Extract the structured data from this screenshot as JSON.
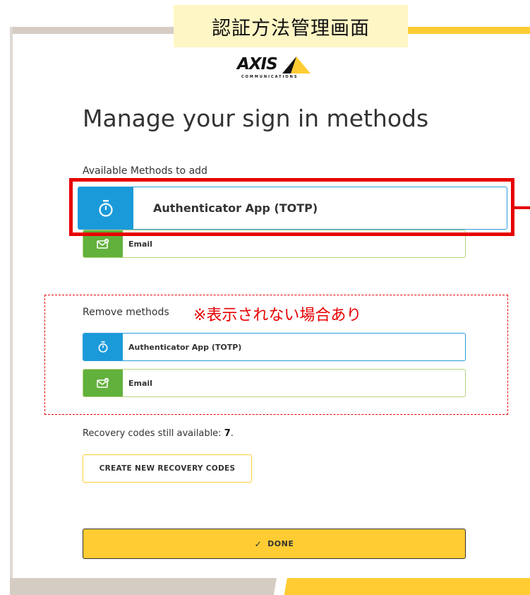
{
  "annotation": {
    "jp_title": "認証方法管理画面",
    "jp_note": "※表示されない場合あり"
  },
  "brand": {
    "logo_text": "AXIS",
    "logo_subtext": "COMMUNICATIONS",
    "accent_color": "#ffcc33",
    "totp_color": "#1b9ad9",
    "email_color": "#62b13d",
    "highlight_color": "#e60000"
  },
  "page": {
    "title": "Manage your sign in methods"
  },
  "available": {
    "label": "Available Methods to add",
    "methods": [
      {
        "label": "Authenticator App (TOTP)",
        "icon": "stopwatch-icon"
      },
      {
        "label": "Email",
        "icon": "envelope-icon"
      }
    ]
  },
  "remove": {
    "label": "Remove methods",
    "methods": [
      {
        "label": "Authenticator App (TOTP)",
        "icon": "stopwatch-icon"
      },
      {
        "label": "Email",
        "icon": "envelope-icon"
      }
    ]
  },
  "recovery": {
    "text_prefix": "Recovery codes still available: ",
    "count": "7",
    "text_suffix": ".",
    "create_button": "CREATE NEW RECOVERY CODES"
  },
  "done": {
    "label": "DONE",
    "icon": "check-icon"
  }
}
